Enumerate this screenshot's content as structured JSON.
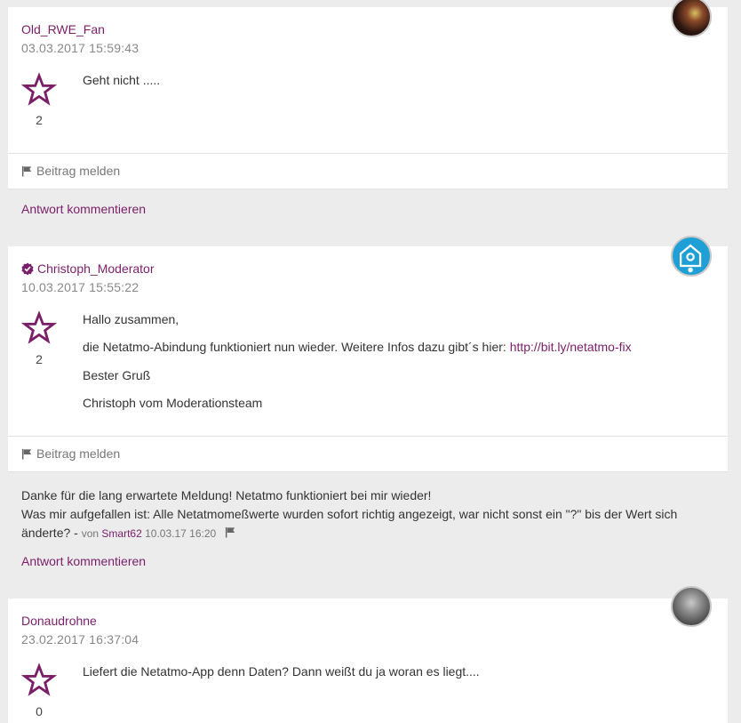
{
  "posts": [
    {
      "author": "Old_RWE_Fan",
      "date": "03.03.2017 15:59:43",
      "votes": "2",
      "lines": [
        "Geht nicht ....."
      ],
      "report_label": "Beitrag melden",
      "reply_label": "Antwort kommentieren"
    },
    {
      "author": "Christoph_Moderator",
      "date": "10.03.2017 15:55:22",
      "votes": "2",
      "lines": [
        "Hallo zusammen,",
        "die Netatmo-Abindung funktioniert nun wieder. Weitere Infos dazu gibt´s hier: ",
        "Bester Gruß",
        "Christoph vom Moderationsteam"
      ],
      "link": "http://bit.ly/netatmo-fix",
      "report_label": "Beitrag melden",
      "comment": {
        "line1": "Danke für die lang erwartete Meldung! Netatmo funktioniert bei mir wieder!",
        "line2": "Was mir aufgefallen ist: Alle Netatmomeßwerte wurden sofort richtig angezeigt, war nicht sonst ein \"?\" bis der Wert sich",
        "line3": "änderte? - ",
        "by_prefix": "von ",
        "by_user": "Smart62",
        "by_date": " 10.03.17 16:20"
      },
      "reply_label": "Antwort kommentieren"
    },
    {
      "author": "Donaudrohne",
      "date": "23.02.2017 16:37:04",
      "votes": "0",
      "lines": [
        "Liefert die Netatmo-App denn Daten? Dann weißt du ja woran es liegt...."
      ]
    }
  ],
  "colors": {
    "accent": "#7a1e68",
    "background": "#ececec",
    "card": "#ffffff"
  }
}
